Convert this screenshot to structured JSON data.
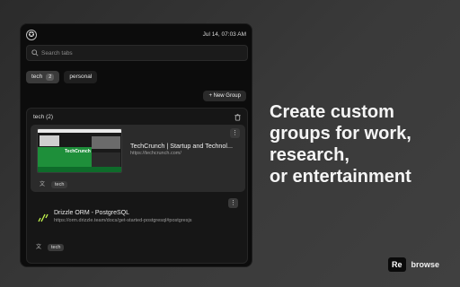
{
  "header": {
    "datetime": "Jul 14, 07:03 AM"
  },
  "search": {
    "placeholder": "Search tabs"
  },
  "group_tabs": [
    {
      "label": "tech",
      "count": "2",
      "active": true
    },
    {
      "label": "personal"
    }
  ],
  "actions": {
    "new_group": "+ New Group"
  },
  "group": {
    "title": "tech (2)",
    "items": [
      {
        "title": "TechCrunch | Startup and Technol...",
        "url": "https://techcrunch.com/",
        "tag": "tech",
        "thumb_text": "TechCrunch"
      },
      {
        "title": "Drizzle ORM - PostgreSQL",
        "url": "https://orm.drizzle.team/docs/get-started-postgresql#postgresjs",
        "tag": "tech"
      }
    ]
  },
  "headline": [
    "Create custom",
    "groups for work,",
    "research,",
    "or entertainment"
  ],
  "brand": {
    "badge": "Re",
    "name": "browse"
  },
  "icons": {
    "logo": "star-circle-icon",
    "search": "search-icon",
    "trash": "trash-icon",
    "more": "more-vertical-icon",
    "translate": "translate-icon",
    "drizzle": "drizzle-logo-icon"
  }
}
